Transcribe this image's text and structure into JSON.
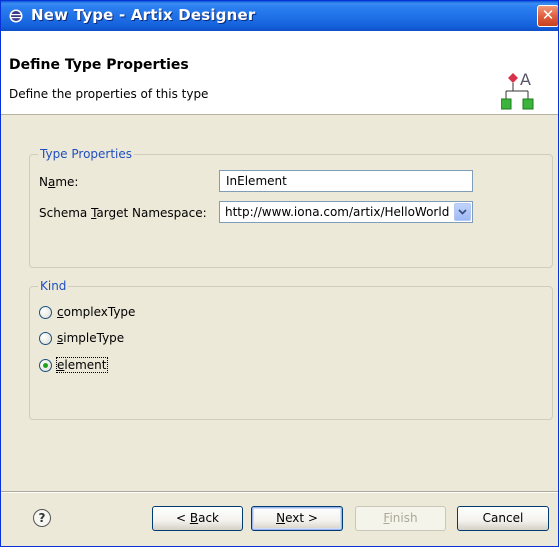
{
  "window": {
    "title": "New Type - Artix Designer",
    "close_label": "✕"
  },
  "banner": {
    "title": "Define Type Properties",
    "description": "Define the properties of this type"
  },
  "type_properties": {
    "legend": "Type Properties",
    "name_label_pre": "N",
    "name_label_ul": "a",
    "name_label_post": "me:",
    "name_value": "InElement",
    "ns_label_pre": "Schema ",
    "ns_label_ul": "T",
    "ns_label_post": "arget Namespace:",
    "ns_value": "http://www.iona.com/artix/HelloWorld"
  },
  "kind": {
    "legend": "Kind",
    "options": [
      {
        "ul": "c",
        "rest": "omplexType",
        "selected": false
      },
      {
        "ul": "s",
        "rest": "impleType",
        "selected": false
      },
      {
        "ul": "e",
        "rest": "lement",
        "selected": true
      }
    ]
  },
  "buttons": {
    "help": "?",
    "back_pre": "< ",
    "back_ul": "B",
    "back_post": "ack",
    "next_ul": "N",
    "next_post": "ext >",
    "finish_ul": "F",
    "finish_post": "inish",
    "cancel": "Cancel"
  },
  "colors": {
    "titlebar": "#0a5ad8",
    "legend_text": "#1f4fbf",
    "radio_selected": "#21a121"
  }
}
